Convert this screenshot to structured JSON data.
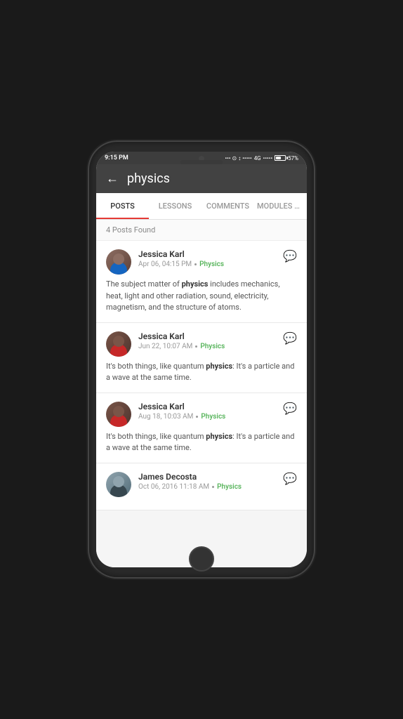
{
  "statusBar": {
    "time": "9:15 PM",
    "battery": "57%",
    "signal": "4G"
  },
  "header": {
    "backLabel": "←",
    "searchQuery": "physics"
  },
  "tabs": [
    {
      "id": "posts",
      "label": "POSTS",
      "active": true
    },
    {
      "id": "lessons",
      "label": "LESSONS",
      "active": false
    },
    {
      "id": "comments",
      "label": "COMMENTS",
      "active": false
    },
    {
      "id": "modules",
      "label": "MODULES & S",
      "active": false
    }
  ],
  "resultsCount": "4 Posts Found",
  "posts": [
    {
      "id": 1,
      "author": "Jessica Karl",
      "date": "Apr 06, 04:15 PM",
      "topic": "Physics",
      "content": "The subject matter of physics includes mechanics, heat, light and other radiation, sound, electricity, magnetism, and the structure of atoms.",
      "avatarType": "female1"
    },
    {
      "id": 2,
      "author": "Jessica Karl",
      "date": "Jun 22, 10:07 AM",
      "topic": "Physics",
      "content": "It's both things, like quantum physics: It's a particle and a wave at the same time.",
      "avatarType": "female2"
    },
    {
      "id": 3,
      "author": "Jessica Karl",
      "date": "Aug 18, 10:03 AM",
      "topic": "Physics",
      "content": "It's both things, like quantum physics: It's a particle and a wave at the same time.",
      "avatarType": "female2"
    },
    {
      "id": 4,
      "author": "James Decosta",
      "date": "Oct 06, 2016 11:18 AM",
      "topic": "Physics",
      "content": "",
      "avatarType": "male"
    }
  ]
}
